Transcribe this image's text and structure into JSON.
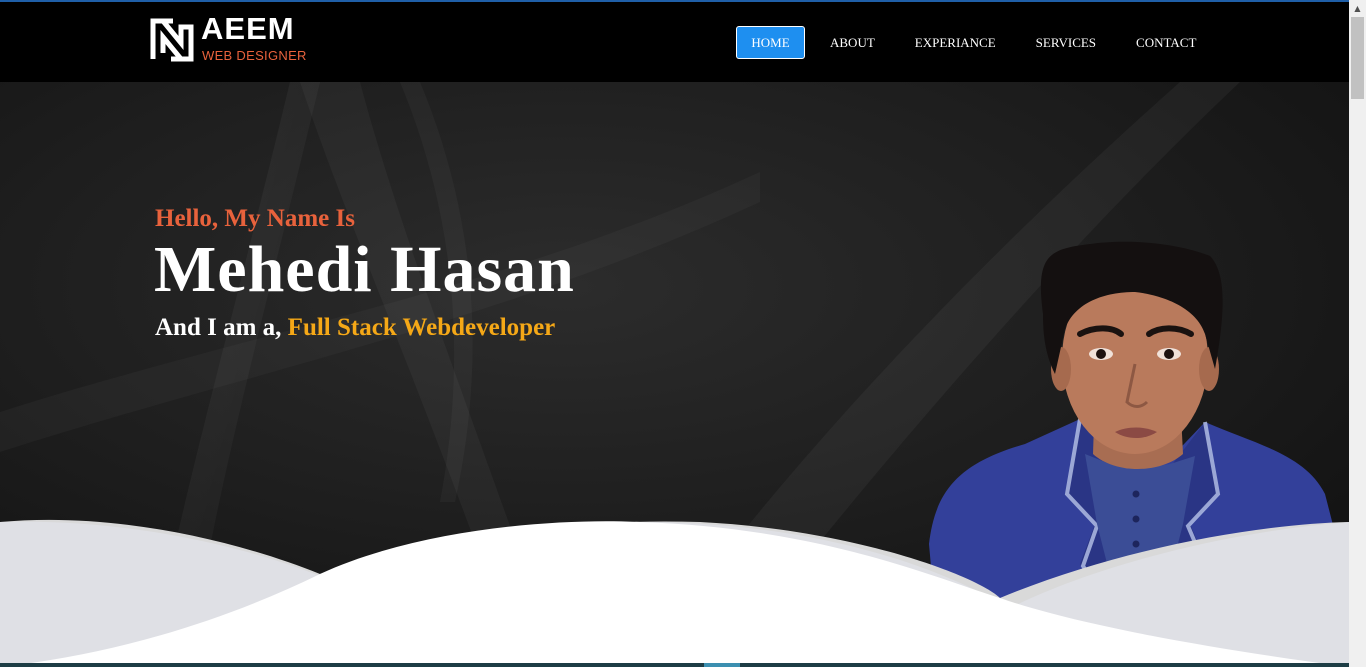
{
  "logo": {
    "mark_icon": "n-monogram-icon",
    "wordmark": "AEEM",
    "tagline": "WEB DESIGNER",
    "accent_color": "#e8623c"
  },
  "nav": {
    "items": [
      {
        "label": "HOME",
        "active": true
      },
      {
        "label": "ABOUT",
        "active": false
      },
      {
        "label": "EXPERIANCE",
        "active": false
      },
      {
        "label": "SERVICES",
        "active": false
      },
      {
        "label": "CONTACT",
        "active": false
      }
    ],
    "active_color": "#1e8ff0"
  },
  "hero": {
    "greeting": "Hello, My Name Is",
    "name": "Mehedi Hasan",
    "role_prefix": "And I am a, ",
    "role_title": "Full Stack Webdeveloper",
    "greeting_color": "#e8623c",
    "role_title_color": "#f5a817",
    "portrait_icon": "person-portrait-icon"
  }
}
